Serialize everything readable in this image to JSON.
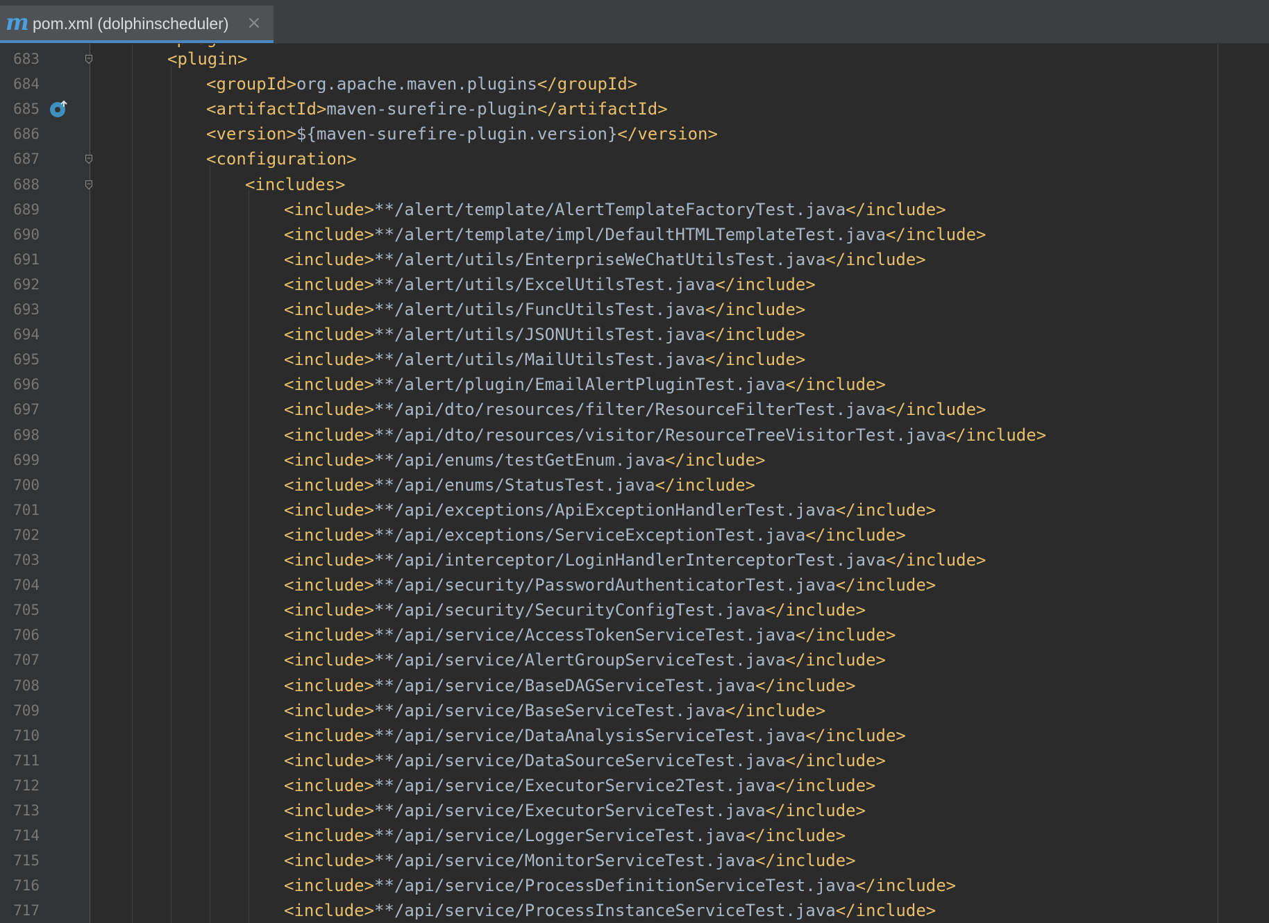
{
  "tab": {
    "icon": "m",
    "label": "pom.xml (dolphinscheduler)",
    "close": "×"
  },
  "editor": {
    "lines": [
      {
        "num": "683",
        "indent": 1,
        "tag_open": "<plugin>",
        "text": "",
        "tag_close": "",
        "fold": true
      },
      {
        "num": "684",
        "indent": 2,
        "tag_open": "<groupId>",
        "text": "org.apache.maven.plugins",
        "tag_close": "</groupId>"
      },
      {
        "num": "685",
        "indent": 2,
        "tag_open": "<artifactId>",
        "text": "maven-surefire-plugin",
        "tag_close": "</artifactId>",
        "marker": "override-icon"
      },
      {
        "num": "686",
        "indent": 2,
        "tag_open": "<version>",
        "text": "${maven-surefire-plugin.version}",
        "tag_close": "</version>"
      },
      {
        "num": "687",
        "indent": 2,
        "tag_open": "<configuration>",
        "text": "",
        "tag_close": "",
        "fold": true
      },
      {
        "num": "688",
        "indent": 3,
        "tag_open": "<includes>",
        "text": "",
        "tag_close": "",
        "fold": true
      },
      {
        "num": "689",
        "indent": 4,
        "tag_open": "<include>",
        "text": "**/alert/template/AlertTemplateFactoryTest.java",
        "tag_close": "</include>"
      },
      {
        "num": "690",
        "indent": 4,
        "tag_open": "<include>",
        "text": "**/alert/template/impl/DefaultHTMLTemplateTest.java",
        "tag_close": "</include>"
      },
      {
        "num": "691",
        "indent": 4,
        "tag_open": "<include>",
        "text": "**/alert/utils/EnterpriseWeChatUtilsTest.java",
        "tag_close": "</include>"
      },
      {
        "num": "692",
        "indent": 4,
        "tag_open": "<include>",
        "text": "**/alert/utils/ExcelUtilsTest.java",
        "tag_close": "</include>"
      },
      {
        "num": "693",
        "indent": 4,
        "tag_open": "<include>",
        "text": "**/alert/utils/FuncUtilsTest.java",
        "tag_close": "</include>"
      },
      {
        "num": "694",
        "indent": 4,
        "tag_open": "<include>",
        "text": "**/alert/utils/JSONUtilsTest.java",
        "tag_close": "</include>"
      },
      {
        "num": "695",
        "indent": 4,
        "tag_open": "<include>",
        "text": "**/alert/utils/MailUtilsTest.java",
        "tag_close": "</include>"
      },
      {
        "num": "696",
        "indent": 4,
        "tag_open": "<include>",
        "text": "**/alert/plugin/EmailAlertPluginTest.java",
        "tag_close": "</include>"
      },
      {
        "num": "697",
        "indent": 4,
        "tag_open": "<include>",
        "text": "**/api/dto/resources/filter/ResourceFilterTest.java",
        "tag_close": "</include>"
      },
      {
        "num": "698",
        "indent": 4,
        "tag_open": "<include>",
        "text": "**/api/dto/resources/visitor/ResourceTreeVisitorTest.java",
        "tag_close": "</include>"
      },
      {
        "num": "699",
        "indent": 4,
        "tag_open": "<include>",
        "text": "**/api/enums/testGetEnum.java",
        "tag_close": "</include>"
      },
      {
        "num": "700",
        "indent": 4,
        "tag_open": "<include>",
        "text": "**/api/enums/StatusTest.java",
        "tag_close": "</include>"
      },
      {
        "num": "701",
        "indent": 4,
        "tag_open": "<include>",
        "text": "**/api/exceptions/ApiExceptionHandlerTest.java",
        "tag_close": "</include>"
      },
      {
        "num": "702",
        "indent": 4,
        "tag_open": "<include>",
        "text": "**/api/exceptions/ServiceExceptionTest.java",
        "tag_close": "</include>"
      },
      {
        "num": "703",
        "indent": 4,
        "tag_open": "<include>",
        "text": "**/api/interceptor/LoginHandlerInterceptorTest.java",
        "tag_close": "</include>"
      },
      {
        "num": "704",
        "indent": 4,
        "tag_open": "<include>",
        "text": "**/api/security/PasswordAuthenticatorTest.java",
        "tag_close": "</include>"
      },
      {
        "num": "705",
        "indent": 4,
        "tag_open": "<include>",
        "text": "**/api/security/SecurityConfigTest.java",
        "tag_close": "</include>"
      },
      {
        "num": "706",
        "indent": 4,
        "tag_open": "<include>",
        "text": "**/api/service/AccessTokenServiceTest.java",
        "tag_close": "</include>"
      },
      {
        "num": "707",
        "indent": 4,
        "tag_open": "<include>",
        "text": "**/api/service/AlertGroupServiceTest.java",
        "tag_close": "</include>"
      },
      {
        "num": "708",
        "indent": 4,
        "tag_open": "<include>",
        "text": "**/api/service/BaseDAGServiceTest.java",
        "tag_close": "</include>"
      },
      {
        "num": "709",
        "indent": 4,
        "tag_open": "<include>",
        "text": "**/api/service/BaseServiceTest.java",
        "tag_close": "</include>"
      },
      {
        "num": "710",
        "indent": 4,
        "tag_open": "<include>",
        "text": "**/api/service/DataAnalysisServiceTest.java",
        "tag_close": "</include>"
      },
      {
        "num": "711",
        "indent": 4,
        "tag_open": "<include>",
        "text": "**/api/service/DataSourceServiceTest.java",
        "tag_close": "</include>"
      },
      {
        "num": "712",
        "indent": 4,
        "tag_open": "<include>",
        "text": "**/api/service/ExecutorService2Test.java",
        "tag_close": "</include>"
      },
      {
        "num": "713",
        "indent": 4,
        "tag_open": "<include>",
        "text": "**/api/service/ExecutorServiceTest.java",
        "tag_close": "</include>"
      },
      {
        "num": "714",
        "indent": 4,
        "tag_open": "<include>",
        "text": "**/api/service/LoggerServiceTest.java",
        "tag_close": "</include>"
      },
      {
        "num": "715",
        "indent": 4,
        "tag_open": "<include>",
        "text": "**/api/service/MonitorServiceTest.java",
        "tag_close": "</include>"
      },
      {
        "num": "716",
        "indent": 4,
        "tag_open": "<include>",
        "text": "**/api/service/ProcessDefinitionServiceTest.java",
        "tag_close": "</include>"
      },
      {
        "num": "717",
        "indent": 4,
        "tag_open": "<include>",
        "text": "**/api/service/ProcessInstanceServiceTest.java",
        "tag_close": "</include>"
      }
    ]
  },
  "colors": {
    "background": "#2b2b2b",
    "gutter": "#313335",
    "tag": "#e8bf6a",
    "text": "#a9b7c6",
    "line_number": "#777777",
    "accent": "#4a88c7"
  }
}
